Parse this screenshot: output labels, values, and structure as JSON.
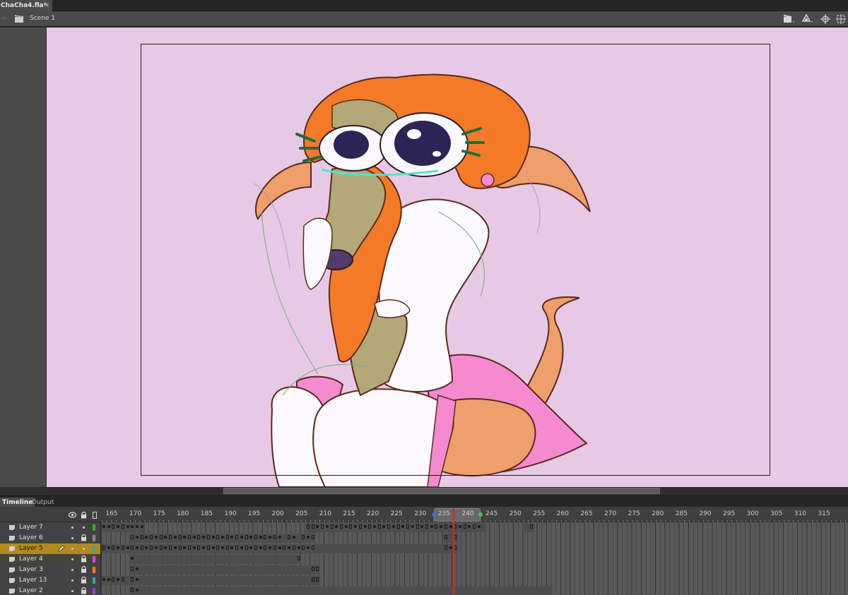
{
  "document": {
    "tab_title": "ChaCha4.fla*",
    "close_glyph": "×"
  },
  "editbar": {
    "scene_label": "Scene 1",
    "back_glyph": "⇦"
  },
  "timeline_tabs": {
    "timeline_label": "Timeline",
    "output_label": "Output"
  },
  "ruler": {
    "labels": [
      "165",
      "170",
      "175",
      "180",
      "185",
      "190",
      "195",
      "200",
      "205",
      "210",
      "215",
      "220",
      "225",
      "230",
      "235",
      "240",
      "245",
      "250",
      "255",
      "260",
      "265",
      "270",
      "275",
      "280",
      "285",
      "290",
      "295",
      "300",
      "305",
      "310",
      "315"
    ],
    "current_frame": 238
  },
  "layers": [
    {
      "name": "Layer 7",
      "locked": false,
      "color": "#45a82a",
      "selected": false
    },
    {
      "name": "Layer 6",
      "locked": true,
      "color": "#8a8a8a",
      "selected": false
    },
    {
      "name": "Layer 5",
      "locked": false,
      "color": "#1fb0a6",
      "selected": true
    },
    {
      "name": "Layer 4",
      "locked": true,
      "color": "#e83ff0",
      "selected": false
    },
    {
      "name": "Layer 3",
      "locked": true,
      "color": "#f07a1a",
      "selected": false
    },
    {
      "name": "Layer 13",
      "locked": true,
      "color": "#1fb0a6",
      "selected": false
    },
    {
      "name": "Layer 2",
      "locked": true,
      "color": "#9b3ad8",
      "selected": false
    }
  ],
  "colors": {
    "pasteboard": "#e8c9e5",
    "accent_playhead": "#d0282b",
    "selection": "#b08a1e"
  },
  "icons": [
    "scene-clapper-icon",
    "edit-symbols-icon",
    "zoom-to-stage-icon",
    "center-stage-icon",
    "eye-icon",
    "lock-icon",
    "outline-icon",
    "pencil-icon",
    "layer-icon"
  ]
}
